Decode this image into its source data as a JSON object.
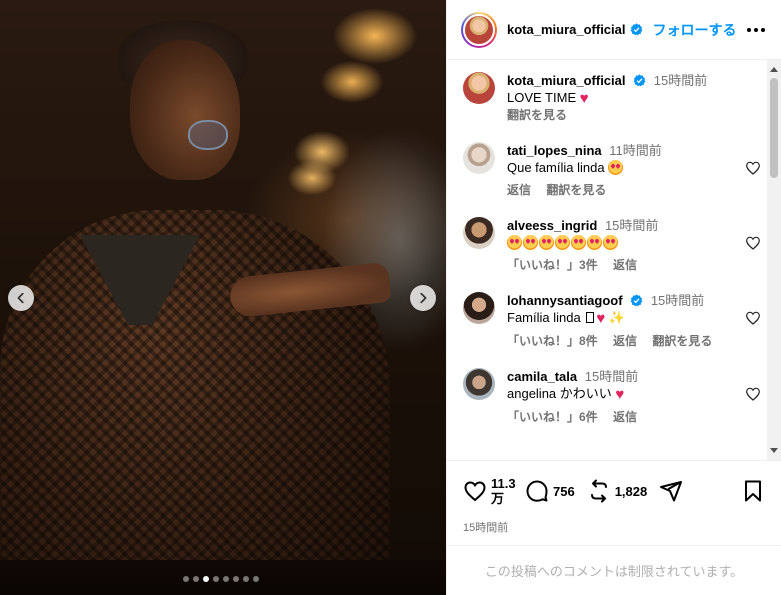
{
  "photo": {
    "carousel_total": 8,
    "carousel_active": 2
  },
  "header": {
    "username": "kota_miura_official",
    "follow_label": "フォローする"
  },
  "caption": {
    "username": "kota_miura_official",
    "time": "15時間前",
    "text": "LOVE TIME",
    "translate": "翻訳を見る"
  },
  "comments": [
    {
      "username": "tati_lopes_nina",
      "time": "11時間前",
      "text": "Que família linda",
      "meta": [
        "返信",
        "翻訳を見る"
      ]
    },
    {
      "username": "alveess_ingrid",
      "time": "15時間前",
      "text": "",
      "meta": [
        "「いいね！」3件",
        "返信"
      ]
    },
    {
      "username": "lohannysantiagoof",
      "time": "15時間前",
      "text": "Família linda",
      "meta": [
        "「いいね！」8件",
        "返信",
        "翻訳を見る"
      ]
    },
    {
      "username": "camila_tala",
      "time": "15時間前",
      "text": "angelina かわいい",
      "meta": [
        "「いいね！」6件",
        "返信"
      ]
    }
  ],
  "actions": {
    "likes": "11.3万",
    "likes_line1": "11.3",
    "likes_line2": "万",
    "comments": "756",
    "shares": "1,828",
    "timestamp": "15時間前"
  },
  "comment_restricted": "この投稿へのコメントは制限されています。",
  "colors": {
    "accent": "#0095f6",
    "verified": "#0095f6",
    "heart": "#e0245e",
    "muted": "#737373"
  }
}
